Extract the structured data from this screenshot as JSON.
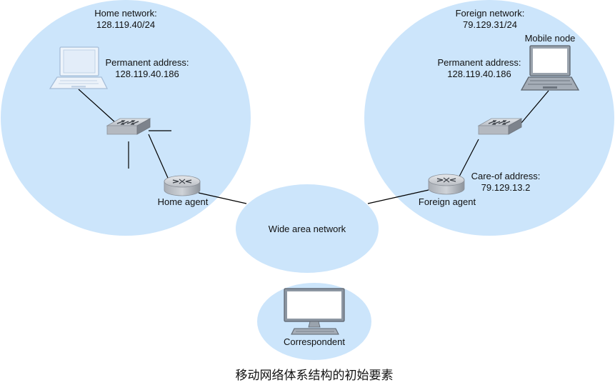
{
  "colors": {
    "network_fill": "#cce5fb",
    "device_gray": "#b7bcc3",
    "device_dark": "#7e858e",
    "screen_blue": "#dde9f7",
    "laptop_outline": "#a6bdd8",
    "line": "#000000"
  },
  "home_network": {
    "title": "Home network:",
    "subnet": "128.119.40/24",
    "permanent_label": "Permanent address:",
    "permanent_address": "128.119.40.186",
    "agent_label": "Home agent"
  },
  "foreign_network": {
    "title": "Foreign network:",
    "subnet": "79.129.31/24",
    "mobile_node_label": "Mobile node",
    "permanent_label": "Permanent address:",
    "permanent_address": "128.119.40.186",
    "care_of_label": "Care-of address:",
    "care_of_address": "79.129.13.2",
    "agent_label": "Foreign agent"
  },
  "wan": {
    "label": "Wide area network"
  },
  "correspondent": {
    "label": "Correspondent"
  },
  "caption": "移动网络体系结构的初始要素",
  "icons": {
    "home_laptop": "laptop-icon",
    "home_switch": "switch-icon",
    "home_router": "router-icon",
    "mobile_laptop": "laptop-icon",
    "foreign_switch": "switch-icon",
    "foreign_router": "router-icon",
    "correspondent_pc": "desktop-monitor-icon"
  }
}
